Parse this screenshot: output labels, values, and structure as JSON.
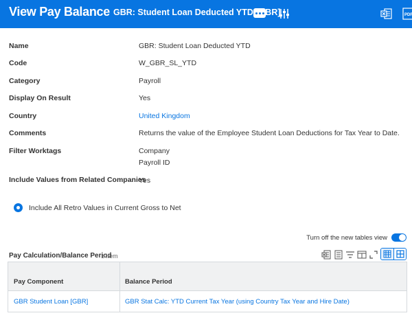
{
  "header": {
    "title": "View Pay Balance",
    "subtitle": "GBR: Student Loan Deducted YTD [GBR]",
    "brand_color": "#0875e1",
    "icons": [
      "more-options-icon",
      "related-actions-icon",
      "export-excel-icon",
      "export-pdf-icon"
    ]
  },
  "fields": [
    {
      "label": "Name",
      "value": "GBR: Student Loan Deducted YTD"
    },
    {
      "label": "Code",
      "value": "W_GBR_SL_YTD"
    },
    {
      "label": "Category",
      "value": "Payroll"
    },
    {
      "label": "Display On Result",
      "value": "Yes"
    },
    {
      "label": "Country",
      "value": "United Kingdom",
      "link": true
    },
    {
      "label": "Comments",
      "value": "Returns the value of the Employee Student Loan Deductions for Tax Year to Date."
    },
    {
      "label": "Filter Worktags",
      "values": [
        "Company",
        "Payroll ID"
      ]
    },
    {
      "label": "Include Values from Related Companies",
      "value": "Yes"
    }
  ],
  "retro_option": {
    "label": "Include All Retro Values in Current Gross to Net",
    "selected": true
  },
  "tables_toggle": {
    "label": "Turn off the new tables view",
    "on": true
  },
  "table": {
    "title": "Pay Calculation/Balance Period",
    "count": "1 item",
    "toolbar_icons": [
      "export-excel-icon",
      "export-pdf-icon",
      "filter-icon",
      "columns-icon",
      "fullscreen-icon",
      "grid-view-icon",
      "table-view-icon"
    ],
    "columns": [
      "Pay Component",
      "Balance Period"
    ],
    "rows": [
      [
        "GBR Student Loan [GBR]",
        "GBR Stat Calc: YTD Current Tax Year (using Country Tax Year and Hire Date)"
      ]
    ]
  }
}
